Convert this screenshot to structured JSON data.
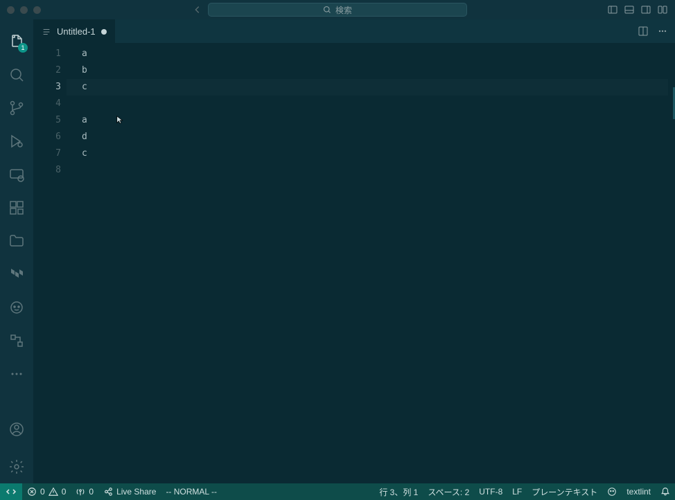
{
  "titlebar": {
    "search_placeholder": "検索"
  },
  "activity": {
    "explorer_badge": "1"
  },
  "tabs": {
    "active": {
      "label": "Untitled-1"
    }
  },
  "editor": {
    "lines": [
      "a",
      "b",
      "c",
      "",
      "a",
      "d",
      "c",
      ""
    ],
    "line_numbers": [
      "1",
      "2",
      "3",
      "4",
      "5",
      "6",
      "7",
      "8"
    ],
    "current_line_index": 2
  },
  "status": {
    "errors": "0",
    "warnings": "0",
    "ports": "0",
    "live_share": "Live Share",
    "vim_mode": "-- NORMAL --",
    "cursor": "行 3、列 1",
    "spaces": "スペース: 2",
    "encoding": "UTF-8",
    "eol": "LF",
    "language": "プレーンテキスト",
    "textlint": "textlint"
  }
}
